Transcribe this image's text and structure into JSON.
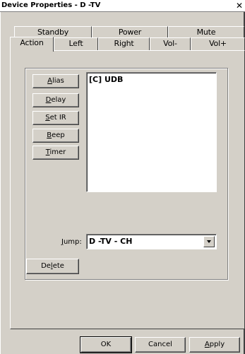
{
  "window": {
    "title": "Device Properties - D -TV",
    "close_glyph": "✕"
  },
  "tabs": {
    "row1": [
      {
        "label": "Standby"
      },
      {
        "label": "Power"
      },
      {
        "label": "Mute"
      }
    ],
    "row2": [
      {
        "label": "Action",
        "active": true
      },
      {
        "label": "Left"
      },
      {
        "label": "Right"
      },
      {
        "label": "Vol-"
      },
      {
        "label": "Vol+"
      }
    ]
  },
  "actions": {
    "alias": {
      "mnemonic": "A",
      "rest": "lias"
    },
    "delay": {
      "mnemonic": "D",
      "rest": "elay"
    },
    "set_ir": {
      "mnemonic": "S",
      "rest": "et IR"
    },
    "beep": {
      "mnemonic": "B",
      "rest": "eep"
    },
    "timer": {
      "mnemonic": "T",
      "rest": "imer"
    },
    "delete": {
      "before": "De",
      "mnemonic": "l",
      "rest": "ete"
    }
  },
  "action_list": {
    "items": [
      "[C] UDB"
    ]
  },
  "jump": {
    "label_mnemonic": "J",
    "label_rest": "ump:",
    "value": "D -TV - CH"
  },
  "footer": {
    "ok_label": "OK",
    "cancel_label": "Cancel",
    "apply_mnemonic": "A",
    "apply_rest": "pply"
  },
  "colors": {
    "face": "#d4d0c8",
    "highlight": "#ffffff",
    "shadow": "#808080",
    "dark_shadow": "#404040"
  }
}
